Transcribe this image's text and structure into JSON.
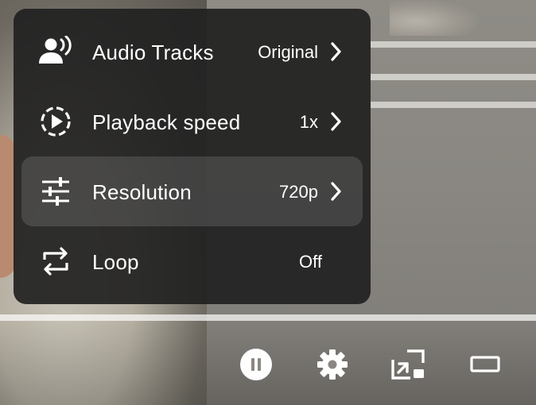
{
  "player": {
    "progress_fraction": 1.0
  },
  "settings_menu": {
    "items": [
      {
        "icon": "audio-tracks-icon",
        "label": "Audio Tracks",
        "value": "Original",
        "has_submenu": true,
        "active": false
      },
      {
        "icon": "playback-speed-icon",
        "label": "Playback speed",
        "value": "1x",
        "has_submenu": true,
        "active": false
      },
      {
        "icon": "sliders-icon",
        "label": "Resolution",
        "value": "720p",
        "has_submenu": true,
        "active": true
      },
      {
        "icon": "loop-icon",
        "label": "Loop",
        "value": "Off",
        "has_submenu": false,
        "active": false
      }
    ]
  },
  "controls": [
    {
      "icon": "pause-icon"
    },
    {
      "icon": "gear-icon"
    },
    {
      "icon": "exit-pip-icon"
    },
    {
      "icon": "theater-mode-icon"
    }
  ],
  "colors": {
    "menu_background": "#212121",
    "text": "#ffffff"
  }
}
